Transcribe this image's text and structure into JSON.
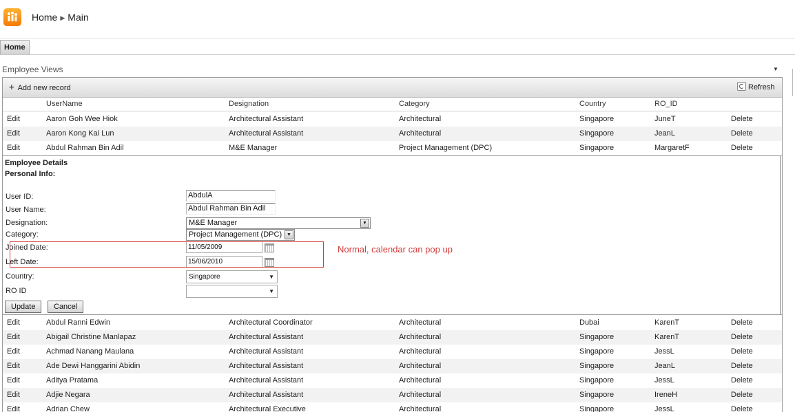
{
  "breadcrumb": {
    "home": "Home",
    "main": "Main"
  },
  "tabs": {
    "home": "Home"
  },
  "views": {
    "title": "Employee Views"
  },
  "toolbar": {
    "add_label": "Add new record",
    "refresh_label": "Refresh"
  },
  "columns": {
    "username": "UserName",
    "designation": "Designation",
    "category": "Category",
    "country": "Country",
    "ro_id": "RO_ID"
  },
  "row_actions": {
    "edit": "Edit",
    "delete": "Delete"
  },
  "rows_top": [
    {
      "username": "Aaron Goh Wee Hiok",
      "designation": "Architectural Assistant",
      "category": "Architectural",
      "country": "Singapore",
      "ro_id": "JuneT"
    },
    {
      "username": "Aaron Kong Kai Lun",
      "designation": "Architectural Assistant",
      "category": "Architectural",
      "country": "Singapore",
      "ro_id": "JeanL"
    },
    {
      "username": "Abdul Rahman Bin Adil",
      "designation": "M&E Manager",
      "category": "Project Management (DPC)",
      "country": "Singapore",
      "ro_id": "MargaretF"
    }
  ],
  "form": {
    "title": "Employee Details",
    "section": "Personal Info:",
    "user_id_label": "User ID:",
    "user_id_value": "AbdulA",
    "user_name_label": "User Name:",
    "user_name_value": "Abdul Rahman Bin Adil",
    "designation_label": "Designation:",
    "designation_value": "M&E Manager",
    "category_label": "Category:",
    "category_value": "Project Management (DPC)",
    "joined_label": "Joined  Date:",
    "joined_value": "11/05/2009",
    "left_label": "Left  Date:",
    "left_value": "15/06/2010",
    "country_label": "Country:",
    "country_value": "Singapore",
    "ro_label": "RO ID",
    "ro_value": "",
    "update_label": "Update",
    "cancel_label": "Cancel"
  },
  "annotation": {
    "text": "Normal, calendar can pop up",
    "color": "#d43a3a"
  },
  "rows_bottom": [
    {
      "username": "Abdul Ranni Edwin",
      "designation": "Architectural Coordinator",
      "category": "Architectural",
      "country": "Dubai",
      "ro_id": "KarenT"
    },
    {
      "username": "Abigail Christine Manlapaz",
      "designation": "Architectural Assistant",
      "category": "Architectural",
      "country": "Singapore",
      "ro_id": "KarenT"
    },
    {
      "username": "Achmad Nanang Maulana",
      "designation": "Architectural Assistant",
      "category": "Architectural",
      "country": "Singapore",
      "ro_id": "JessL"
    },
    {
      "username": "Ade Dewi Hanggarini Abidin",
      "designation": "Architectural Assistant",
      "category": "Architectural",
      "country": "Singapore",
      "ro_id": "JeanL"
    },
    {
      "username": "Aditya Pratama",
      "designation": "Architectural Assistant",
      "category": "Architectural",
      "country": "Singapore",
      "ro_id": "JessL"
    },
    {
      "username": "Adjie Negara",
      "designation": "Architectural Assistant",
      "category": "Architectural",
      "country": "Singapore",
      "ro_id": "IreneH"
    },
    {
      "username": "Adrian Chew",
      "designation": "Architectural Executive",
      "category": "Architectural",
      "country": "Singapore",
      "ro_id": "JessL"
    }
  ]
}
